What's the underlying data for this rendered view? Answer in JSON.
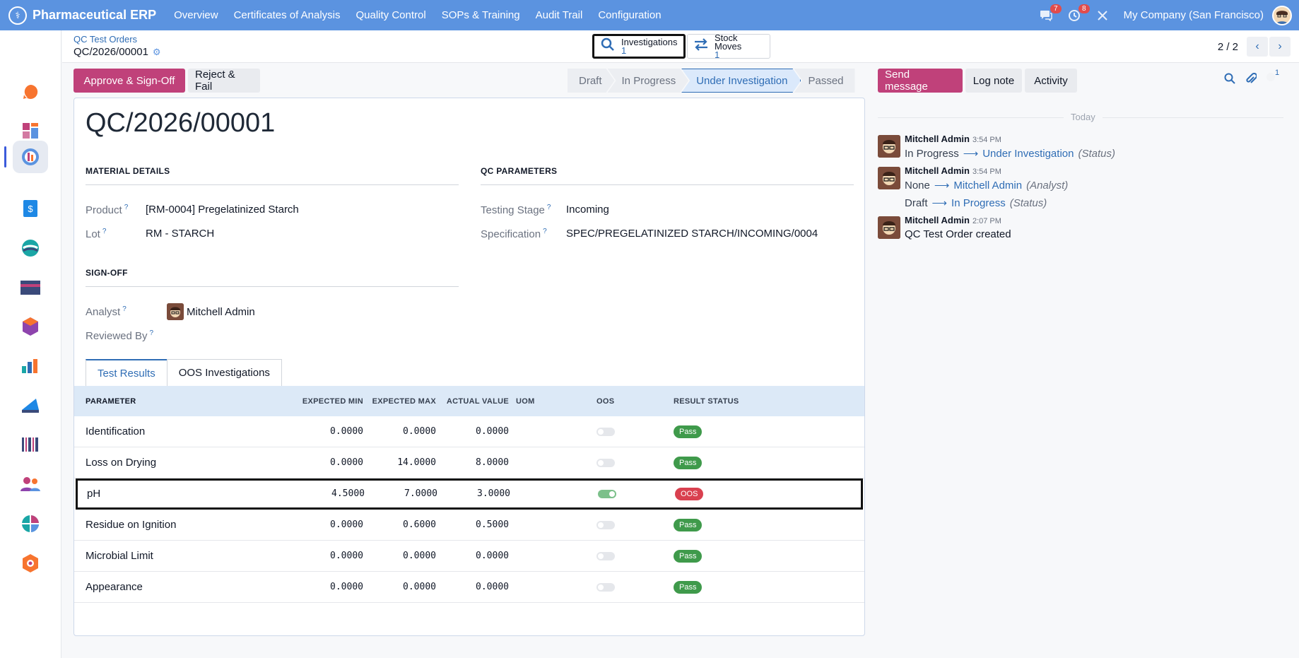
{
  "app": {
    "brand": "Pharmaceutical ERP",
    "menu": [
      "Overview",
      "Certificates of Analysis",
      "Quality Control",
      "SOPs & Training",
      "Audit Trail",
      "Configuration"
    ],
    "messages_badge": "7",
    "activities_badge": "8",
    "company": "My Company (San Francisco)"
  },
  "rail": {
    "icons": [
      {
        "name": "discuss-icon",
        "color": "#f7742f"
      },
      {
        "name": "dashboard-icon",
        "color": "#c0417a"
      },
      {
        "name": "quality-control-icon",
        "color": "#5b93e0"
      },
      {
        "name": "invoicing-icon",
        "color": "#1e88e5"
      },
      {
        "name": "sync-icon",
        "color": "#1aa6a6"
      },
      {
        "name": "payment-icon",
        "color": "#3a4a7a"
      },
      {
        "name": "inventory-icon",
        "color": "#8e44ad"
      },
      {
        "name": "reporting-icon",
        "color": "#2f6db5"
      },
      {
        "name": "documents-icon",
        "color": "#1e88e5"
      },
      {
        "name": "barcode-icon",
        "color": "#3a4a7a"
      },
      {
        "name": "employees-icon",
        "color": "#c0417a"
      },
      {
        "name": "pie-chart-icon",
        "color": "#1aa6a6"
      },
      {
        "name": "settings-app-icon",
        "color": "#f7742f"
      }
    ]
  },
  "breadcrumb": {
    "parent": "QC Test Orders",
    "current": "QC/2026/00001"
  },
  "smart_buttons": {
    "investigations": {
      "label": "Investigations",
      "count": "1"
    },
    "stock_moves": {
      "label": "Stock Moves",
      "count": "1"
    }
  },
  "pager": {
    "value": "2 / 2"
  },
  "actions": {
    "approve": "Approve & Sign-Off",
    "reject": "Reject & Fail"
  },
  "statusbar": {
    "stages": [
      "Draft",
      "In Progress",
      "Under Investigation",
      "Passed"
    ],
    "current": "Under Investigation"
  },
  "form": {
    "title": "QC/2026/00001",
    "material_details": {
      "title": "MATERIAL DETAILS",
      "product_label": "Product",
      "product": "[RM-0004] Pregelatinized Starch",
      "lot_label": "Lot",
      "lot": "RM - STARCH"
    },
    "qc_parameters": {
      "title": "QC PARAMETERS",
      "stage_label": "Testing Stage",
      "stage": "Incoming",
      "spec_label": "Specification",
      "spec": "SPEC/PREGELATINIZED STARCH/INCOMING/0004"
    },
    "signoff": {
      "title": "SIGN-OFF",
      "analyst_label": "Analyst",
      "analyst": "Mitchell Admin",
      "reviewed_label": "Reviewed By"
    },
    "help_mark": "?",
    "tabs": [
      "Test Results",
      "OOS Investigations"
    ],
    "table": {
      "headers": [
        "PARAMETER",
        "EXPECTED MIN",
        "EXPECTED MAX",
        "ACTUAL VALUE",
        "UOM",
        "OOS",
        "RESULT STATUS"
      ],
      "rows": [
        {
          "param": "Identification",
          "min": "0.0000",
          "max": "0.0000",
          "actual": "0.0000",
          "uom": "",
          "oos": false,
          "status": "Pass"
        },
        {
          "param": "Loss on Drying",
          "min": "0.0000",
          "max": "14.0000",
          "actual": "8.0000",
          "uom": "",
          "oos": false,
          "status": "Pass"
        },
        {
          "param": "pH",
          "min": "4.5000",
          "max": "7.0000",
          "actual": "3.0000",
          "uom": "",
          "oos": true,
          "status": "OOS"
        },
        {
          "param": "Residue on Ignition",
          "min": "0.0000",
          "max": "0.6000",
          "actual": "0.5000",
          "uom": "",
          "oos": false,
          "status": "Pass"
        },
        {
          "param": "Microbial Limit",
          "min": "0.0000",
          "max": "0.0000",
          "actual": "0.0000",
          "uom": "",
          "oos": false,
          "status": "Pass"
        },
        {
          "param": "Appearance",
          "min": "0.0000",
          "max": "0.0000",
          "actual": "0.0000",
          "uom": "",
          "oos": false,
          "status": "Pass"
        }
      ]
    }
  },
  "chatter": {
    "send_message": "Send message",
    "log_note": "Log note",
    "activity": "Activity",
    "followers_count": "1",
    "date_separator": "Today",
    "messages": [
      {
        "author": "Mitchell Admin",
        "time": "3:54 PM",
        "lines": [
          {
            "old": "In Progress",
            "new": "Under Investigation",
            "field": "(Status)"
          }
        ]
      },
      {
        "author": "Mitchell Admin",
        "time": "3:54 PM",
        "lines": [
          {
            "old": "None",
            "new": "Mitchell Admin",
            "field": "(Analyst)"
          },
          {
            "old": "Draft",
            "new": "In Progress",
            "field": "(Status)"
          }
        ]
      },
      {
        "author": "Mitchell Admin",
        "time": "2:07 PM",
        "body": "QC Test Order created"
      }
    ]
  }
}
